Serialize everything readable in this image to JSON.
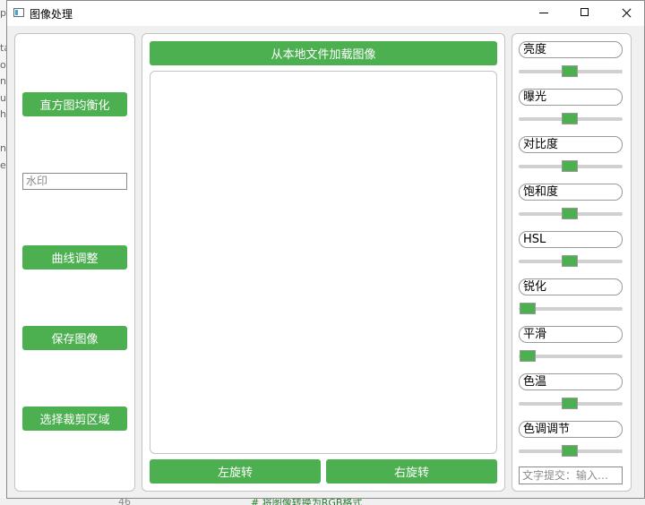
{
  "window": {
    "title": "图像处理"
  },
  "background": {
    "line_number": "46",
    "comment": "# 将图像转换为RGB格式",
    "side_chars": [
      "p",
      "ta",
      "o",
      "ne",
      "ur",
      "ha",
      "ny",
      "es"
    ]
  },
  "left_panel": {
    "histogram_button": "直方图均衡化",
    "watermark_placeholder": "水印",
    "curve_button": "曲线调整",
    "save_button": "保存图像",
    "crop_button": "选择裁剪区域"
  },
  "center_panel": {
    "load_button": "从本地文件加载图像",
    "rotate_left_button": "左旋转",
    "rotate_right_button": "右旋转"
  },
  "right_panel": {
    "adjustments": [
      {
        "label": "亮度",
        "value": 0.5
      },
      {
        "label": "曝光",
        "value": 0.5
      },
      {
        "label": "对比度",
        "value": 0.5
      },
      {
        "label": "饱和度",
        "value": 0.5
      },
      {
        "label": "HSL",
        "value": 0.5
      },
      {
        "label": "锐化",
        "value": 0.0
      },
      {
        "label": "平滑",
        "value": 0.0
      },
      {
        "label": "色温",
        "value": 0.5
      },
      {
        "label": "色调调节",
        "value": 0.5
      }
    ],
    "text_input_placeholder": "文字提交：输入…"
  },
  "colors": {
    "accent": "#4caf50"
  }
}
